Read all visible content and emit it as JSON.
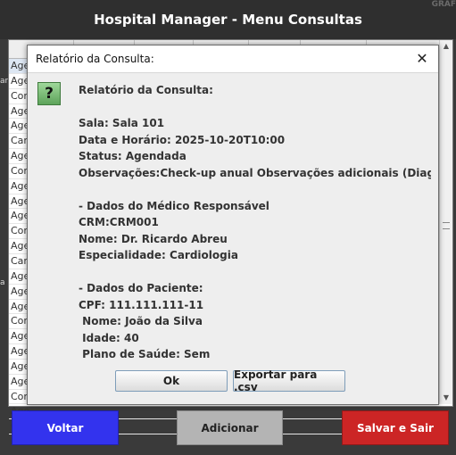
{
  "app": {
    "title": "Hospital Manager - Menu Consultas",
    "corner_text": "GRAF"
  },
  "table": {
    "visible_rows": [
      "Age",
      "Age",
      "Con",
      "Age",
      "Age",
      "Can",
      "Age",
      "Con",
      "Age",
      "Age",
      "Age",
      "Con",
      "Age",
      "Can",
      "Age",
      "Age",
      "Age",
      "Con",
      "Age",
      "Age",
      "Age",
      "Age",
      "Con",
      "Age",
      "Con"
    ],
    "selected_row": 0
  },
  "buttons": {
    "voltar": "Voltar",
    "adicionar": "Adicionar",
    "salvar": "Salvar e Sair"
  },
  "colors": {
    "voltar": "#3333ee",
    "adicionar": "#b4b4b4",
    "salvar": "#cc2525"
  },
  "dialog": {
    "title": "Relatório da Consulta:",
    "icon": "question-icon",
    "heading": "Relatório da Consulta:",
    "sala": "Sala: Sala 101",
    "data_horario": "Data e Horário: 2025-10-20T10:00",
    "status": "Status: Agendada",
    "observacoes": "Observações:Check-up anual Observações adicionais (Diagnósticos",
    "medico_header": "- Dados do Médico Responsável",
    "crm": "CRM:CRM001",
    "medico_nome": "Nome: Dr. Ricardo Abreu",
    "especialidade": "Especialidade: Cardiologia",
    "paciente_header": "- Dados do Paciente:",
    "cpf": "CPF: 111.111.111-11",
    "paciente_nome": " Nome: João da Silva",
    "idade": " Idade: 40",
    "plano": " Plano de Saúde: Sem",
    "ok_label": "Ok",
    "csv_label": "Exportar para .csv"
  }
}
